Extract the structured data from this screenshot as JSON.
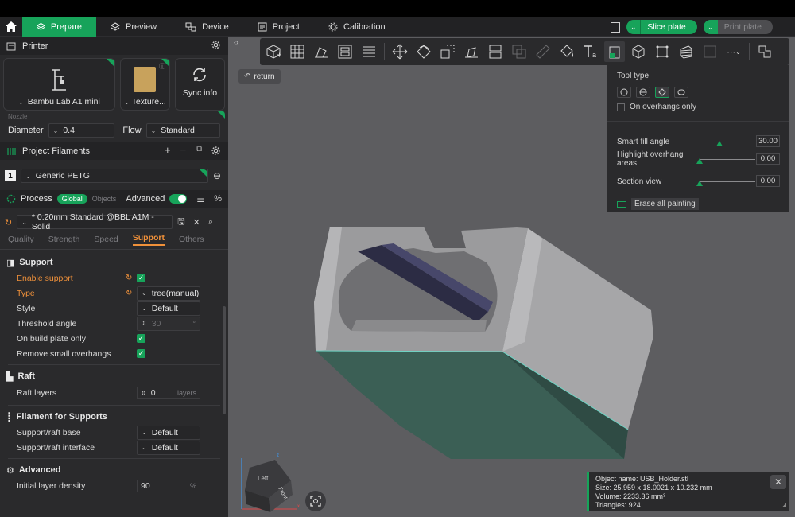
{
  "menu": {
    "tabs": [
      {
        "label": "Prepare",
        "active": true
      },
      {
        "label": "Preview"
      },
      {
        "label": "Device"
      },
      {
        "label": "Project"
      },
      {
        "label": "Calibration"
      }
    ],
    "slice_label": "Slice plate",
    "print_label": "Print plate"
  },
  "printer": {
    "title": "Printer",
    "printer_name": "Bambu Lab A1 mini",
    "plate_name": "Texture...",
    "sync_label": "Sync info",
    "nozzle_label": "Nozzle",
    "diameter_label": "Diameter",
    "diameter_value": "0.4",
    "flow_label": "Flow",
    "flow_value": "Standard"
  },
  "filaments": {
    "title": "Project Filaments",
    "items": [
      {
        "index": "1",
        "name": "Generic PETG"
      }
    ]
  },
  "process": {
    "title": "Process",
    "global_label": "Global",
    "objects_label": "Objects",
    "advanced_label": "Advanced",
    "preset": "* 0.20mm Standard @BBL A1M - Solid",
    "tabs": [
      "Quality",
      "Strength",
      "Speed",
      "Support",
      "Others"
    ],
    "active_tab": "Support",
    "support": {
      "title": "Support",
      "enable_label": "Enable support",
      "type_label": "Type",
      "type_value": "tree(manual)",
      "style_label": "Style",
      "style_value": "Default",
      "threshold_label": "Threshold angle",
      "threshold_value": "30",
      "threshold_unit": "°",
      "build_plate_label": "On build plate only",
      "remove_small_label": "Remove small overhangs"
    },
    "raft": {
      "title": "Raft",
      "layers_label": "Raft layers",
      "layers_value": "0",
      "layers_unit": "layers"
    },
    "filament_supports": {
      "title": "Filament for Supports",
      "base_label": "Support/raft base",
      "base_value": "Default",
      "interface_label": "Support/raft interface",
      "interface_value": "Default"
    },
    "advanced": {
      "title": "Advanced",
      "density_label": "Initial layer density",
      "density_value": "90",
      "density_unit": "%"
    }
  },
  "viewport": {
    "return_label": "return",
    "paint": {
      "tool_type_label": "Tool type",
      "overhangs_label": "On overhangs only",
      "smart_fill_label": "Smart fill angle",
      "smart_fill_value": "30.00",
      "smart_fill_fraction": 0.36,
      "highlight_label": "Highlight overhang areas",
      "highlight_value": "0.00",
      "highlight_fraction": 0.0,
      "section_label": "Section view",
      "section_value": "0.00",
      "section_fraction": 0.0,
      "erase_label": "Erase all painting"
    },
    "cube": {
      "left": "Left",
      "front": "Front"
    },
    "object_info": {
      "name": "Object name: USB_Holder.stl",
      "size": "Size: 25.959 x 18.0021 x 10.232 mm",
      "volume": "Volume: 2233.36 mm³",
      "triangles": "Triangles: 924"
    }
  },
  "colors": {
    "accent": "#17a35a",
    "orange": "#f0913a",
    "viewport_bg": "#5d5d60",
    "panel_bg": "#2a2a2c"
  }
}
